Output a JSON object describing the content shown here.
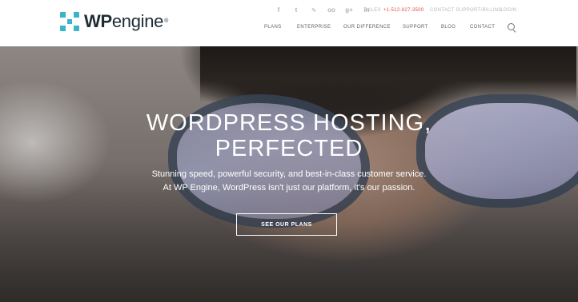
{
  "header": {
    "logo": {
      "wp": "WP",
      "engine": "engine",
      "reg": "®"
    },
    "social_icons": [
      {
        "name": "facebook-icon",
        "glyph": "f"
      },
      {
        "name": "twitter-icon",
        "glyph": "t"
      },
      {
        "name": "rss-icon",
        "glyph": "∿"
      },
      {
        "name": "flickr-icon",
        "glyph": "oo"
      },
      {
        "name": "google-plus-icon",
        "glyph": "g+"
      },
      {
        "name": "linkedin-icon",
        "glyph": "in"
      }
    ],
    "sales_label": "SALES",
    "sales_phone": "+1-512-827-3500",
    "contact_support": "CONTACT SUPPORT/BILLING",
    "login": "LOGIN",
    "nav": [
      "PLANS",
      "ENTERPRISE",
      "OUR DIFFERENCE",
      "SUPPORT",
      "BLOG",
      "CONTACT"
    ]
  },
  "hero": {
    "headline_line1": "WORDPRESS HOSTING,",
    "headline_line2": "PERFECTED",
    "sub_line1": "Stunning speed, powerful security, and best-in-class customer service.",
    "sub_line2": "At WP Engine, WordPress isn't just our platform, it's our passion.",
    "cta": "SEE OUR PLANS"
  },
  "colors": {
    "brand_teal": "#3ab5c6",
    "phone_red": "#e34b4b"
  }
}
